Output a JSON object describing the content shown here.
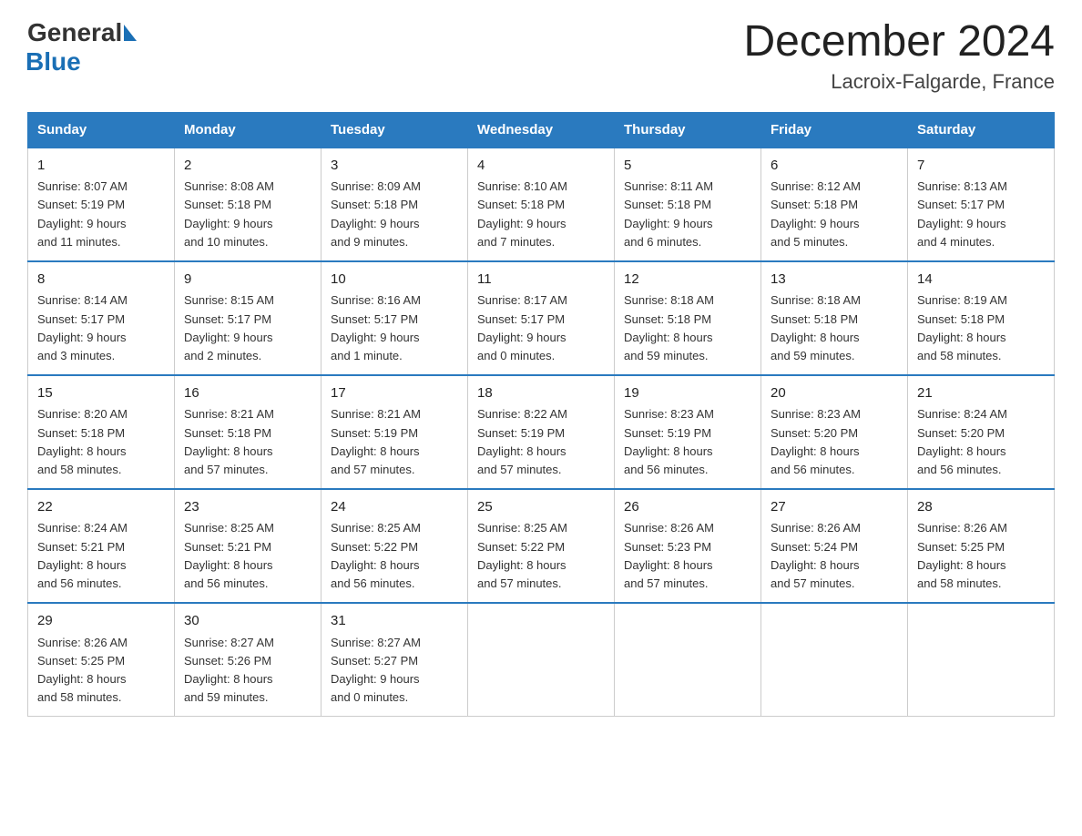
{
  "header": {
    "logo_general": "General",
    "logo_blue": "Blue",
    "month_year": "December 2024",
    "location": "Lacroix-Falgarde, France"
  },
  "days_of_week": [
    "Sunday",
    "Monday",
    "Tuesday",
    "Wednesday",
    "Thursday",
    "Friday",
    "Saturday"
  ],
  "weeks": [
    [
      {
        "day": "1",
        "info": "Sunrise: 8:07 AM\nSunset: 5:19 PM\nDaylight: 9 hours\nand 11 minutes."
      },
      {
        "day": "2",
        "info": "Sunrise: 8:08 AM\nSunset: 5:18 PM\nDaylight: 9 hours\nand 10 minutes."
      },
      {
        "day": "3",
        "info": "Sunrise: 8:09 AM\nSunset: 5:18 PM\nDaylight: 9 hours\nand 9 minutes."
      },
      {
        "day": "4",
        "info": "Sunrise: 8:10 AM\nSunset: 5:18 PM\nDaylight: 9 hours\nand 7 minutes."
      },
      {
        "day": "5",
        "info": "Sunrise: 8:11 AM\nSunset: 5:18 PM\nDaylight: 9 hours\nand 6 minutes."
      },
      {
        "day": "6",
        "info": "Sunrise: 8:12 AM\nSunset: 5:18 PM\nDaylight: 9 hours\nand 5 minutes."
      },
      {
        "day": "7",
        "info": "Sunrise: 8:13 AM\nSunset: 5:17 PM\nDaylight: 9 hours\nand 4 minutes."
      }
    ],
    [
      {
        "day": "8",
        "info": "Sunrise: 8:14 AM\nSunset: 5:17 PM\nDaylight: 9 hours\nand 3 minutes."
      },
      {
        "day": "9",
        "info": "Sunrise: 8:15 AM\nSunset: 5:17 PM\nDaylight: 9 hours\nand 2 minutes."
      },
      {
        "day": "10",
        "info": "Sunrise: 8:16 AM\nSunset: 5:17 PM\nDaylight: 9 hours\nand 1 minute."
      },
      {
        "day": "11",
        "info": "Sunrise: 8:17 AM\nSunset: 5:17 PM\nDaylight: 9 hours\nand 0 minutes."
      },
      {
        "day": "12",
        "info": "Sunrise: 8:18 AM\nSunset: 5:18 PM\nDaylight: 8 hours\nand 59 minutes."
      },
      {
        "day": "13",
        "info": "Sunrise: 8:18 AM\nSunset: 5:18 PM\nDaylight: 8 hours\nand 59 minutes."
      },
      {
        "day": "14",
        "info": "Sunrise: 8:19 AM\nSunset: 5:18 PM\nDaylight: 8 hours\nand 58 minutes."
      }
    ],
    [
      {
        "day": "15",
        "info": "Sunrise: 8:20 AM\nSunset: 5:18 PM\nDaylight: 8 hours\nand 58 minutes."
      },
      {
        "day": "16",
        "info": "Sunrise: 8:21 AM\nSunset: 5:18 PM\nDaylight: 8 hours\nand 57 minutes."
      },
      {
        "day": "17",
        "info": "Sunrise: 8:21 AM\nSunset: 5:19 PM\nDaylight: 8 hours\nand 57 minutes."
      },
      {
        "day": "18",
        "info": "Sunrise: 8:22 AM\nSunset: 5:19 PM\nDaylight: 8 hours\nand 57 minutes."
      },
      {
        "day": "19",
        "info": "Sunrise: 8:23 AM\nSunset: 5:19 PM\nDaylight: 8 hours\nand 56 minutes."
      },
      {
        "day": "20",
        "info": "Sunrise: 8:23 AM\nSunset: 5:20 PM\nDaylight: 8 hours\nand 56 minutes."
      },
      {
        "day": "21",
        "info": "Sunrise: 8:24 AM\nSunset: 5:20 PM\nDaylight: 8 hours\nand 56 minutes."
      }
    ],
    [
      {
        "day": "22",
        "info": "Sunrise: 8:24 AM\nSunset: 5:21 PM\nDaylight: 8 hours\nand 56 minutes."
      },
      {
        "day": "23",
        "info": "Sunrise: 8:25 AM\nSunset: 5:21 PM\nDaylight: 8 hours\nand 56 minutes."
      },
      {
        "day": "24",
        "info": "Sunrise: 8:25 AM\nSunset: 5:22 PM\nDaylight: 8 hours\nand 56 minutes."
      },
      {
        "day": "25",
        "info": "Sunrise: 8:25 AM\nSunset: 5:22 PM\nDaylight: 8 hours\nand 57 minutes."
      },
      {
        "day": "26",
        "info": "Sunrise: 8:26 AM\nSunset: 5:23 PM\nDaylight: 8 hours\nand 57 minutes."
      },
      {
        "day": "27",
        "info": "Sunrise: 8:26 AM\nSunset: 5:24 PM\nDaylight: 8 hours\nand 57 minutes."
      },
      {
        "day": "28",
        "info": "Sunrise: 8:26 AM\nSunset: 5:25 PM\nDaylight: 8 hours\nand 58 minutes."
      }
    ],
    [
      {
        "day": "29",
        "info": "Sunrise: 8:26 AM\nSunset: 5:25 PM\nDaylight: 8 hours\nand 58 minutes."
      },
      {
        "day": "30",
        "info": "Sunrise: 8:27 AM\nSunset: 5:26 PM\nDaylight: 8 hours\nand 59 minutes."
      },
      {
        "day": "31",
        "info": "Sunrise: 8:27 AM\nSunset: 5:27 PM\nDaylight: 9 hours\nand 0 minutes."
      },
      {
        "day": "",
        "info": ""
      },
      {
        "day": "",
        "info": ""
      },
      {
        "day": "",
        "info": ""
      },
      {
        "day": "",
        "info": ""
      }
    ]
  ]
}
